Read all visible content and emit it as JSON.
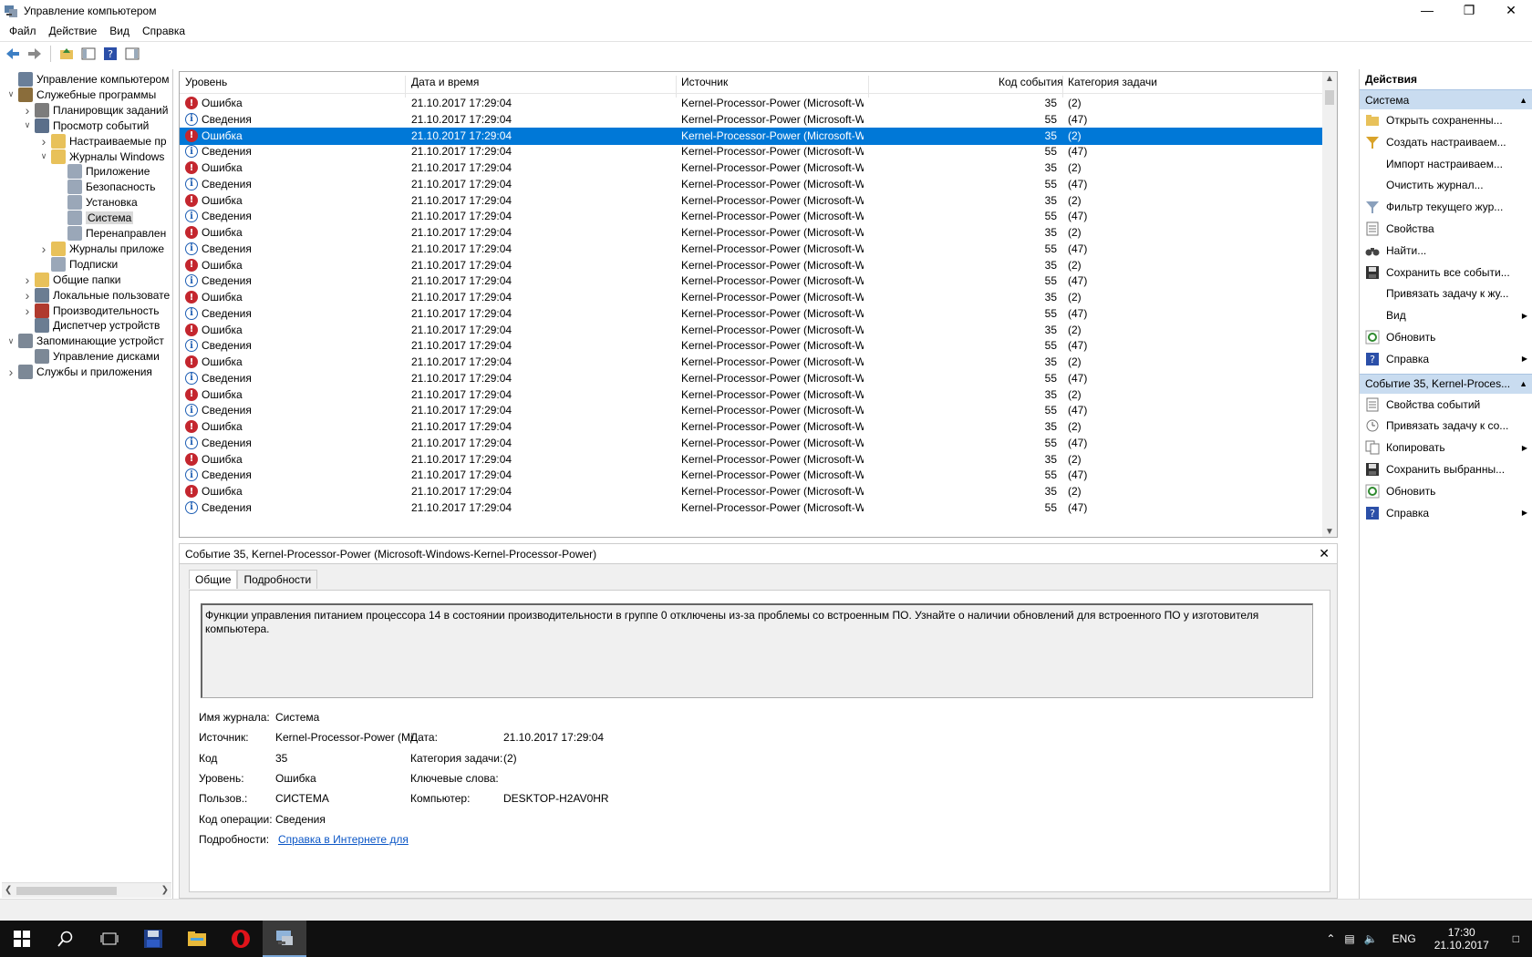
{
  "window": {
    "title": "Управление компьютером"
  },
  "menu": [
    "Файл",
    "Действие",
    "Вид",
    "Справка"
  ],
  "tree": [
    {
      "label": "Управление компьютером (л",
      "depth": 0,
      "chev": "",
      "icon": "computer-management-icon",
      "color": "#6a7f99",
      "sel": false
    },
    {
      "label": "Служебные программы",
      "depth": 0,
      "chev": "open",
      "icon": "tools-icon",
      "color": "#8a6d3b",
      "sel": false
    },
    {
      "label": "Планировщик заданий",
      "depth": 1,
      "chev": "closed",
      "icon": "clock-icon",
      "color": "#7c7c7c",
      "sel": false
    },
    {
      "label": "Просмотр событий",
      "depth": 1,
      "chev": "open",
      "icon": "event-viewer-icon",
      "color": "#5b6f8a",
      "sel": false
    },
    {
      "label": "Настраиваемые пр",
      "depth": 2,
      "chev": "closed",
      "icon": "folder-icon",
      "color": "#e8c15a",
      "sel": false
    },
    {
      "label": "Журналы Windows",
      "depth": 2,
      "chev": "open",
      "icon": "folder-icon",
      "color": "#e8c15a",
      "sel": false
    },
    {
      "label": "Приложение",
      "depth": 3,
      "chev": "",
      "icon": "log-icon",
      "color": "#9aa7b8",
      "sel": false
    },
    {
      "label": "Безопасность",
      "depth": 3,
      "chev": "",
      "icon": "log-icon",
      "color": "#9aa7b8",
      "sel": false
    },
    {
      "label": "Установка",
      "depth": 3,
      "chev": "",
      "icon": "log-icon",
      "color": "#9aa7b8",
      "sel": false
    },
    {
      "label": "Система",
      "depth": 3,
      "chev": "",
      "icon": "log-icon",
      "color": "#9aa7b8",
      "sel": true
    },
    {
      "label": "Перенаправлен",
      "depth": 3,
      "chev": "",
      "icon": "log-icon",
      "color": "#9aa7b8",
      "sel": false
    },
    {
      "label": "Журналы приложе",
      "depth": 2,
      "chev": "closed",
      "icon": "folder-icon",
      "color": "#e8c15a",
      "sel": false
    },
    {
      "label": "Подписки",
      "depth": 2,
      "chev": "",
      "icon": "subscriptions-icon",
      "color": "#9aa7b8",
      "sel": false
    },
    {
      "label": "Общие папки",
      "depth": 1,
      "chev": "closed",
      "icon": "shared-folders-icon",
      "color": "#e8c15a",
      "sel": false
    },
    {
      "label": "Локальные пользовате",
      "depth": 1,
      "chev": "closed",
      "icon": "users-icon",
      "color": "#6b7d92",
      "sel": false
    },
    {
      "label": "Производительность",
      "depth": 1,
      "chev": "closed",
      "icon": "performance-icon",
      "color": "#b03a2e",
      "sel": false
    },
    {
      "label": "Диспетчер устройств",
      "depth": 1,
      "chev": "",
      "icon": "device-manager-icon",
      "color": "#6b7d92",
      "sel": false
    },
    {
      "label": "Запоминающие устройст",
      "depth": 0,
      "chev": "open",
      "icon": "storage-icon",
      "color": "#7c8896",
      "sel": false
    },
    {
      "label": "Управление дисками",
      "depth": 1,
      "chev": "",
      "icon": "disk-icon",
      "color": "#7c8896",
      "sel": false
    },
    {
      "label": "Службы и приложения",
      "depth": 0,
      "chev": "closed",
      "icon": "services-icon",
      "color": "#7c8896",
      "sel": false
    }
  ],
  "grid": {
    "columns": [
      "Уровень",
      "Дата и время",
      "Источник",
      "Код события",
      "Категория задачи"
    ],
    "rows": [
      {
        "level": "Ошибка",
        "type": "err",
        "date": "21.10.2017 17:29:04",
        "source": "Kernel-Processor-Power (Microsoft-Wi...",
        "code": "35",
        "cat": "(2)"
      },
      {
        "level": "Сведения",
        "type": "info",
        "date": "21.10.2017 17:29:04",
        "source": "Kernel-Processor-Power (Microsoft-Wi...",
        "code": "55",
        "cat": "(47)"
      },
      {
        "level": "Ошибка",
        "type": "err",
        "date": "21.10.2017 17:29:04",
        "source": "Kernel-Processor-Power (Microsoft-Wi...",
        "code": "35",
        "cat": "(2)",
        "selected": true
      },
      {
        "level": "Сведения",
        "type": "info",
        "date": "21.10.2017 17:29:04",
        "source": "Kernel-Processor-Power (Microsoft-Wi...",
        "code": "55",
        "cat": "(47)"
      },
      {
        "level": "Ошибка",
        "type": "err",
        "date": "21.10.2017 17:29:04",
        "source": "Kernel-Processor-Power (Microsoft-Wi...",
        "code": "35",
        "cat": "(2)"
      },
      {
        "level": "Сведения",
        "type": "info",
        "date": "21.10.2017 17:29:04",
        "source": "Kernel-Processor-Power (Microsoft-Wi...",
        "code": "55",
        "cat": "(47)"
      },
      {
        "level": "Ошибка",
        "type": "err",
        "date": "21.10.2017 17:29:04",
        "source": "Kernel-Processor-Power (Microsoft-Wi...",
        "code": "35",
        "cat": "(2)"
      },
      {
        "level": "Сведения",
        "type": "info",
        "date": "21.10.2017 17:29:04",
        "source": "Kernel-Processor-Power (Microsoft-Wi...",
        "code": "55",
        "cat": "(47)"
      },
      {
        "level": "Ошибка",
        "type": "err",
        "date": "21.10.2017 17:29:04",
        "source": "Kernel-Processor-Power (Microsoft-Wi...",
        "code": "35",
        "cat": "(2)"
      },
      {
        "level": "Сведения",
        "type": "info",
        "date": "21.10.2017 17:29:04",
        "source": "Kernel-Processor-Power (Microsoft-Wi...",
        "code": "55",
        "cat": "(47)"
      },
      {
        "level": "Ошибка",
        "type": "err",
        "date": "21.10.2017 17:29:04",
        "source": "Kernel-Processor-Power (Microsoft-Wi...",
        "code": "35",
        "cat": "(2)"
      },
      {
        "level": "Сведения",
        "type": "info",
        "date": "21.10.2017 17:29:04",
        "source": "Kernel-Processor-Power (Microsoft-Wi...",
        "code": "55",
        "cat": "(47)"
      },
      {
        "level": "Ошибка",
        "type": "err",
        "date": "21.10.2017 17:29:04",
        "source": "Kernel-Processor-Power (Microsoft-Wi...",
        "code": "35",
        "cat": "(2)"
      },
      {
        "level": "Сведения",
        "type": "info",
        "date": "21.10.2017 17:29:04",
        "source": "Kernel-Processor-Power (Microsoft-Wi...",
        "code": "55",
        "cat": "(47)"
      },
      {
        "level": "Ошибка",
        "type": "err",
        "date": "21.10.2017 17:29:04",
        "source": "Kernel-Processor-Power (Microsoft-Wi...",
        "code": "35",
        "cat": "(2)"
      },
      {
        "level": "Сведения",
        "type": "info",
        "date": "21.10.2017 17:29:04",
        "source": "Kernel-Processor-Power (Microsoft-Wi...",
        "code": "55",
        "cat": "(47)"
      },
      {
        "level": "Ошибка",
        "type": "err",
        "date": "21.10.2017 17:29:04",
        "source": "Kernel-Processor-Power (Microsoft-Wi...",
        "code": "35",
        "cat": "(2)"
      },
      {
        "level": "Сведения",
        "type": "info",
        "date": "21.10.2017 17:29:04",
        "source": "Kernel-Processor-Power (Microsoft-Wi...",
        "code": "55",
        "cat": "(47)"
      },
      {
        "level": "Ошибка",
        "type": "err",
        "date": "21.10.2017 17:29:04",
        "source": "Kernel-Processor-Power (Microsoft-Wi...",
        "code": "35",
        "cat": "(2)"
      },
      {
        "level": "Сведения",
        "type": "info",
        "date": "21.10.2017 17:29:04",
        "source": "Kernel-Processor-Power (Microsoft-Wi...",
        "code": "55",
        "cat": "(47)"
      },
      {
        "level": "Ошибка",
        "type": "err",
        "date": "21.10.2017 17:29:04",
        "source": "Kernel-Processor-Power (Microsoft-Wi...",
        "code": "35",
        "cat": "(2)"
      },
      {
        "level": "Сведения",
        "type": "info",
        "date": "21.10.2017 17:29:04",
        "source": "Kernel-Processor-Power (Microsoft-Wi...",
        "code": "55",
        "cat": "(47)"
      },
      {
        "level": "Ошибка",
        "type": "err",
        "date": "21.10.2017 17:29:04",
        "source": "Kernel-Processor-Power (Microsoft-Wi...",
        "code": "35",
        "cat": "(2)"
      },
      {
        "level": "Сведения",
        "type": "info",
        "date": "21.10.2017 17:29:04",
        "source": "Kernel-Processor-Power (Microsoft-Wi...",
        "code": "55",
        "cat": "(47)"
      },
      {
        "level": "Ошибка",
        "type": "err",
        "date": "21.10.2017 17:29:04",
        "source": "Kernel-Processor-Power (Microsoft-Wi...",
        "code": "35",
        "cat": "(2)"
      },
      {
        "level": "Сведения",
        "type": "info",
        "date": "21.10.2017 17:29:04",
        "source": "Kernel-Processor-Power (Microsoft-Wi...",
        "code": "55",
        "cat": "(47)"
      }
    ]
  },
  "detail": {
    "header": "Событие 35, Kernel-Processor-Power (Microsoft-Windows-Kernel-Processor-Power)",
    "tabs": [
      "Общие",
      "Подробности"
    ],
    "message": "Функции управления питанием процессора 14 в состоянии производительности в группе 0 отключены из-за проблемы со встроенным ПО. Узнайте о наличии обновлений для встроенного ПО у изготовителя компьютера.",
    "fields": {
      "log_name_label": "Имя журнала:",
      "log_name": "Система",
      "source_label": "Источник:",
      "source": "Kernel-Processor-Power (Mi",
      "date_label": "Дата:",
      "date": "21.10.2017 17:29:04",
      "code_label": "Код",
      "code": "35",
      "category_label": "Категория задачи:",
      "category": "(2)",
      "level_label": "Уровень:",
      "level": "Ошибка",
      "keywords_label": "Ключевые слова:",
      "user_label": "Пользов.:",
      "user": "СИСТЕМА",
      "computer_label": "Компьютер:",
      "computer": "DESKTOP-H2AV0HR",
      "opcode_label": "Код операции:",
      "opcode": "Сведения",
      "more_label": "Подробности:",
      "more_link": "Справка в Интернете для "
    }
  },
  "actions": {
    "title": "Действия",
    "section1": "Система",
    "items1": [
      {
        "label": "Открыть сохраненны...",
        "icon": "open-log-icon",
        "sub": false
      },
      {
        "label": "Создать настраиваем...",
        "icon": "filter-create-icon",
        "sub": false
      },
      {
        "label": "Импорт настраиваем...",
        "icon": "",
        "sub": false
      },
      {
        "label": "Очистить журнал...",
        "icon": "",
        "sub": false
      },
      {
        "label": "Фильтр текущего жур...",
        "icon": "filter-icon",
        "sub": false
      },
      {
        "label": "Свойства",
        "icon": "properties-icon",
        "sub": false
      },
      {
        "label": "Найти...",
        "icon": "binoculars-icon",
        "sub": false
      },
      {
        "label": "Сохранить все событи...",
        "icon": "save-icon",
        "sub": false
      },
      {
        "label": "Привязать задачу к жу...",
        "icon": "",
        "sub": false
      },
      {
        "label": "Вид",
        "icon": "",
        "sub": true
      },
      {
        "label": "Обновить",
        "icon": "refresh-icon",
        "sub": false
      },
      {
        "label": "Справка",
        "icon": "help-icon",
        "sub": true
      }
    ],
    "section2": "Событие 35, Kernel-Proces...",
    "items2": [
      {
        "label": "Свойства событий",
        "icon": "properties-icon",
        "sub": false
      },
      {
        "label": "Привязать задачу к со...",
        "icon": "task-icon",
        "sub": false
      },
      {
        "label": "Копировать",
        "icon": "copy-icon",
        "sub": true
      },
      {
        "label": "Сохранить выбранны...",
        "icon": "save-icon",
        "sub": false
      },
      {
        "label": "Обновить",
        "icon": "refresh-icon",
        "sub": false
      },
      {
        "label": "Справка",
        "icon": "help-icon",
        "sub": true
      }
    ]
  },
  "taskbar": {
    "lang": "ENG",
    "time": "17:30",
    "date": "21.10.2017"
  },
  "colors": {
    "selection": "#0078d7",
    "error": "#c4262e",
    "section": "#c9dcf0"
  }
}
